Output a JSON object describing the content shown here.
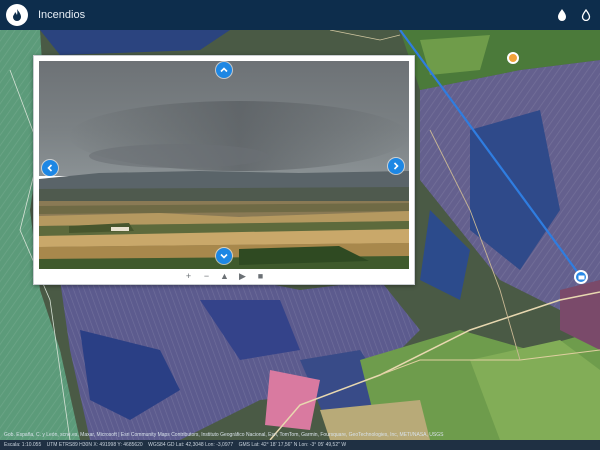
{
  "app": {
    "title": "Incendios"
  },
  "header": {
    "icons": [
      "fire-drop-icon",
      "fire-outline-icon"
    ]
  },
  "viewer": {
    "toolbar": [
      {
        "name": "zoom-in",
        "glyph": "+"
      },
      {
        "name": "zoom-out",
        "glyph": "−"
      },
      {
        "name": "home",
        "glyph": "▲"
      },
      {
        "name": "play",
        "glyph": "▶"
      },
      {
        "name": "stop",
        "glyph": "■"
      }
    ]
  },
  "map": {
    "attribution": "Gob. España, C. y León, scne.es, Maxar, Microsoft | Esri Community Maps Contributors, Instituto Geográfico Nacional, Esri, TomTom, Garmin, Foursquare, GeoTechnologies, Inc, METI/NASA, USGS"
  },
  "status": {
    "scale": "Escala: 1:10.055",
    "utm": "UTM ETRS89 H30N X: 491998  Y: 4685620",
    "wgs": "WGS84 GD Lat: 42,3048  Lon: -3,0977",
    "gms": "GMS Lat: 42° 18' 17,56'' N  Lon: -3° 05' 49,52'' W"
  },
  "colors": {
    "topbar": "#0d2d4c",
    "accent": "#1d87e4",
    "statusbar": "#1f3043",
    "incident": "#f2a33a"
  }
}
